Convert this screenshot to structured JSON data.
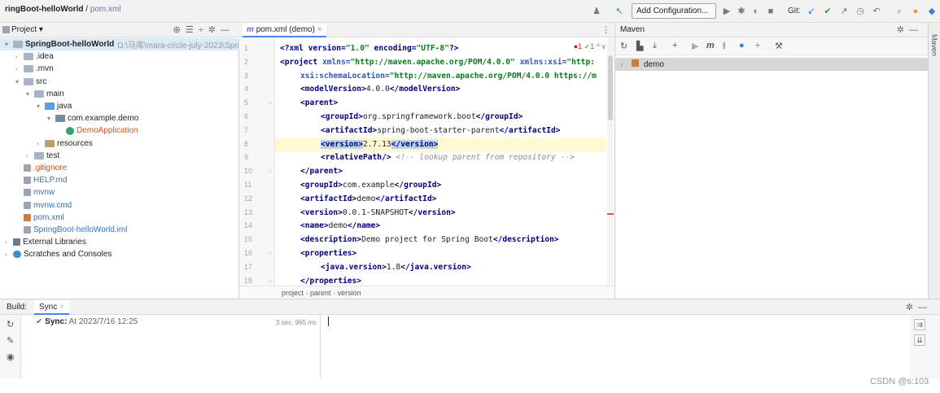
{
  "topbar": {
    "crumb_project": "ringBoot-helloWorld",
    "crumb_sep": " / ",
    "crumb_file": "pom.xml",
    "run_config": "Add Configuration...",
    "git_label": "Git:"
  },
  "project_panel": {
    "title": "Project",
    "tree": [
      {
        "arrow": "▾",
        "icon": "folder",
        "label": "SpringBoot-helloWorld",
        "bold": true,
        "extra": "D:\\马库\\mara-circle-july-2023\\Spri",
        "indent": 0
      },
      {
        "arrow": "›",
        "icon": "folder",
        "label": ".idea",
        "indent": 1
      },
      {
        "arrow": "›",
        "icon": "folder",
        "label": ".mvn",
        "indent": 1
      },
      {
        "arrow": "▾",
        "icon": "folder",
        "label": "src",
        "indent": 1
      },
      {
        "arrow": "▾",
        "icon": "folder",
        "label": "main",
        "indent": 2
      },
      {
        "arrow": "▾",
        "icon": "java",
        "label": "java",
        "indent": 3
      },
      {
        "arrow": "▾",
        "icon": "pkg",
        "label": "com.example.demo",
        "indent": 4
      },
      {
        "arrow": "",
        "icon": "class",
        "label": "DemoApplication",
        "indent": 5,
        "color": "orange"
      },
      {
        "arrow": "›",
        "icon": "res",
        "label": "resources",
        "indent": 3
      },
      {
        "arrow": "›",
        "icon": "folder",
        "label": "test",
        "indent": 2
      },
      {
        "arrow": "",
        "icon": "file",
        "label": ".gitignore",
        "indent": 1,
        "color": "orange"
      },
      {
        "arrow": "",
        "icon": "file",
        "label": "HELP.md",
        "indent": 1,
        "color": "blue"
      },
      {
        "arrow": "",
        "icon": "file",
        "label": "mvnw",
        "indent": 1,
        "color": "blue"
      },
      {
        "arrow": "",
        "icon": "file",
        "label": "mvnw.cmd",
        "indent": 1,
        "color": "blue"
      },
      {
        "arrow": "",
        "icon": "maven",
        "label": "pom.xml",
        "indent": 1,
        "color": "blue"
      },
      {
        "arrow": "",
        "icon": "file",
        "label": "SpringBoot-helloWorld.iml",
        "indent": 1,
        "color": "blue"
      },
      {
        "arrow": "›",
        "icon": "lib",
        "label": "External Libraries",
        "indent": 0
      },
      {
        "arrow": "›",
        "icon": "scratch",
        "label": "Scratches and Consoles",
        "indent": 0
      }
    ]
  },
  "editor": {
    "tab_file": "pom.xml",
    "tab_suffix": " (demo)",
    "inspection_errors": "1",
    "inspection_ok": "1",
    "lines": [
      {
        "n": "1",
        "html_key": "l1"
      },
      {
        "n": "2",
        "html_key": "l2"
      },
      {
        "n": "3",
        "html_key": "l3"
      },
      {
        "n": "4",
        "html_key": "l4"
      },
      {
        "n": "5",
        "html_key": "l5"
      },
      {
        "n": "6",
        "html_key": "l6"
      },
      {
        "n": "7",
        "html_key": "l7"
      },
      {
        "n": "8",
        "html_key": "l8"
      },
      {
        "n": "9",
        "html_key": "l9"
      },
      {
        "n": "10",
        "html_key": "l10"
      },
      {
        "n": "11",
        "html_key": "l11"
      },
      {
        "n": "12",
        "html_key": "l12"
      },
      {
        "n": "13",
        "html_key": "l13"
      },
      {
        "n": "14",
        "html_key": "l14"
      },
      {
        "n": "15",
        "html_key": "l15"
      },
      {
        "n": "16",
        "html_key": "l16"
      },
      {
        "n": "17",
        "html_key": "l17"
      },
      {
        "n": "18",
        "html_key": "l18"
      }
    ],
    "code": {
      "l1a": "<?xml version=",
      "l1b": "\"1.0\"",
      "l1c": " encoding=",
      "l1d": "\"UTF-8\"",
      "l1e": "?>",
      "l2a": "<project ",
      "l2b": "xmlns=",
      "l2c": "\"http://maven.apache.org/POM/4.0.0\"",
      "l2d": " xmlns:xsi=",
      "l2e": "\"http:",
      "l3a": "xsi:schemaLocation=",
      "l3b": "\"http://maven.apache.org/POM/4.0.0 https://m",
      "l4a": "<modelVersion>",
      "l4b": "4.0.0",
      "l4c": "</modelVersion>",
      "l5a": "<parent>",
      "l6a": "<groupId>",
      "l6b": "org.springframework.boot",
      "l6c": "</groupId>",
      "l7a": "<artifactId>",
      "l7b": "spring-boot-starter-parent",
      "l7c": "</artifactId>",
      "l8a": "<version>",
      "l8b": "2.7.13",
      "l8c": "</version>",
      "l9a": "<relativePath/>",
      "l9b": " <!-- lookup parent from repository -->",
      "l10a": "</parent>",
      "l11a": "<groupId>",
      "l11b": "com.example",
      "l11c": "</groupId>",
      "l12a": "<artifactId>",
      "l12b": "demo",
      "l12c": "</artifactId>",
      "l13a": "<version>",
      "l13b": "0.0.1-SNAPSHOT",
      "l13c": "</version>",
      "l14a": "<name>",
      "l14b": "demo",
      "l14c": "</name>",
      "l15a": "<description>",
      "l15b": "Demo project for Spring Boot",
      "l15c": "</description>",
      "l16a": "<properties>",
      "l17a": "<java.version>",
      "l17b": "1.8",
      "l17c": "</java.version>",
      "l18a": "</properties>"
    },
    "breadcrumb": [
      "project",
      "parent",
      "version"
    ]
  },
  "maven_panel": {
    "title": "Maven",
    "side_label": "Maven",
    "project": "demo"
  },
  "build_panel": {
    "label": "Build:",
    "tab": "Sync",
    "sync_label": "Sync:",
    "sync_at": "At 2023/7/16 12:25",
    "sync_time": "3 sec, 965 ms"
  },
  "watermark": "CSDN @s:103"
}
